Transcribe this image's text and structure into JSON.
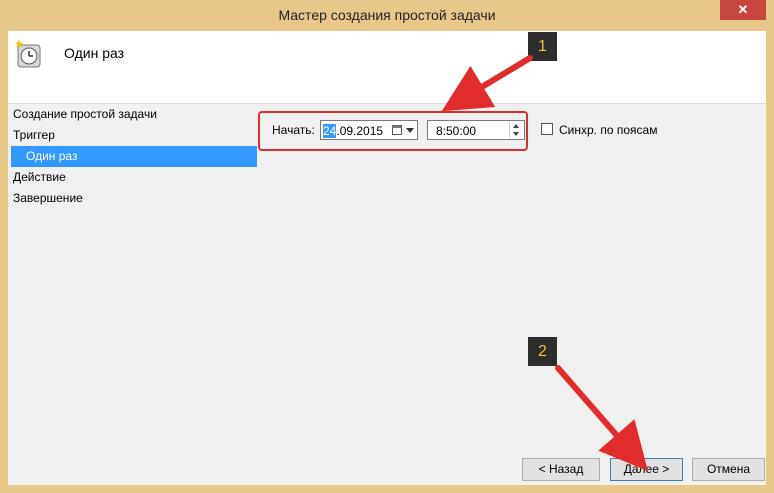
{
  "window": {
    "title": "Мастер создания простой задачи",
    "close_glyph": "✕"
  },
  "header": {
    "title": "Один раз",
    "icon": "clock-icon"
  },
  "sidebar": {
    "items": [
      {
        "label": "Создание простой задачи",
        "selected": false
      },
      {
        "label": "Триггер",
        "selected": false
      },
      {
        "label": "Один раз",
        "selected": true
      },
      {
        "label": "Действие",
        "selected": false
      },
      {
        "label": "Завершение",
        "selected": false
      }
    ]
  },
  "trigger": {
    "start_label": "Начать:",
    "date_selected_part": "24",
    "date_rest": ".09.2015",
    "time_value": "8:50:00",
    "sync_label": "Синхр. по поясам",
    "sync_checked": false
  },
  "buttons": {
    "back": "< Назад",
    "next": "Далее >",
    "cancel": "Отмена"
  },
  "annotations": {
    "badge1": "1",
    "badge2": "2",
    "arrow_color": "#e22c2c"
  }
}
